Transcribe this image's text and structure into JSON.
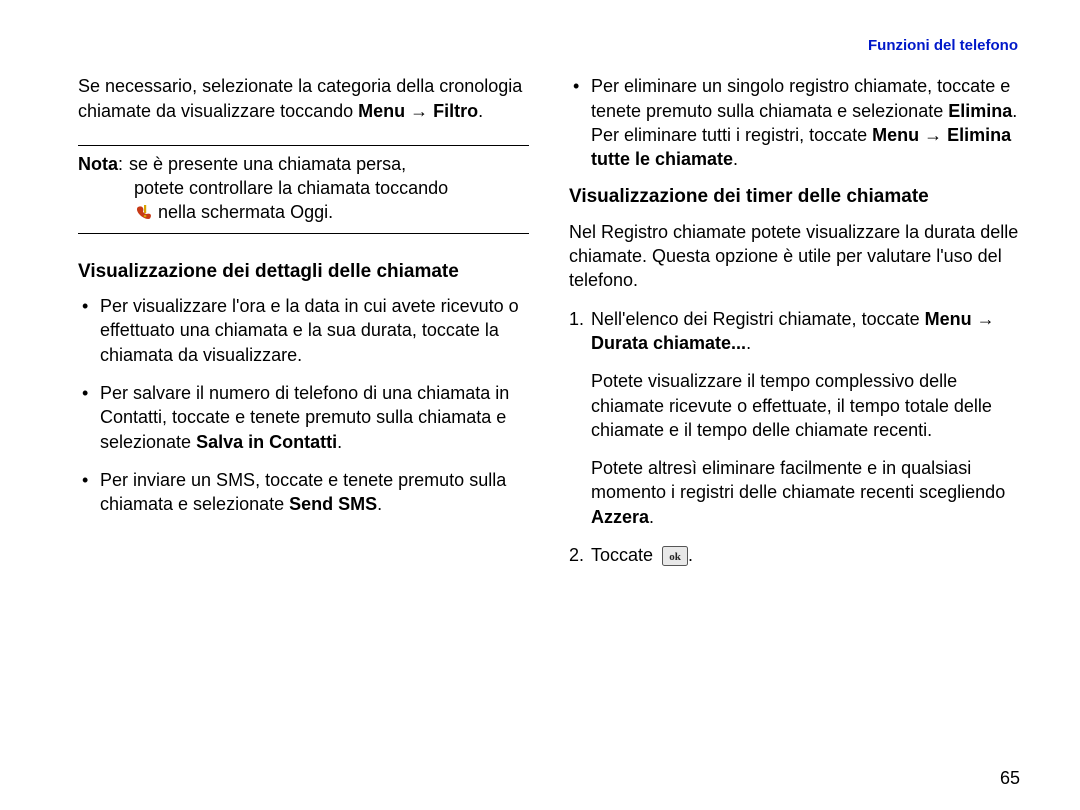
{
  "header": {
    "section_title": "Funzioni del telefono"
  },
  "left": {
    "intro_pre": "Se necessario, selezionate la categoria della cronologia chiamate da visualizzare toccando ",
    "intro_menu": "Menu",
    "intro_arrow": " → ",
    "intro_filtro": "Filtro",
    "intro_period": ".",
    "note_label": "Nota",
    "note_colon": ": ",
    "note_line1a": "se è presente una chiamata persa,",
    "note_line1b": "potete controllare la chiamata toccando",
    "note_line2": " nella schermata Oggi.",
    "subhead": "Visualizzazione dei dettagli delle chiamate",
    "bullets": [
      {
        "text": "Per visualizzare l'ora e la data in cui avete ricevuto o effettuato una chiamata e la sua durata, toccate la chiamata da visualizzare."
      },
      {
        "pre": "Per salvare il numero di telefono di una chiamata in Contatti, toccate e tenete premuto sulla chiamata e selezionate ",
        "bold": "Salva in Contatti",
        "post": "."
      },
      {
        "pre": "Per inviare un SMS, toccate e tenete premuto sulla chiamata e selezionate ",
        "bold": "Send SMS",
        "post": "."
      }
    ]
  },
  "right": {
    "bullets_top": [
      {
        "pre": "Per eliminare un singolo registro chiamate, toccate e tenete premuto sulla chiamata e selezionate ",
        "bold1": "Elimina",
        "mid": ". Per eliminare tutti i registri, toccate ",
        "bold2": "Menu",
        "arrow": " → ",
        "bold3": "Elimina tutte le chiamate",
        "post": "."
      }
    ],
    "subhead": "Visualizzazione dei timer delle chiamate",
    "intro": "Nel Registro chiamate potete visualizzare la durata delle chiamate. Questa opzione è utile per valutare l'uso del telefono.",
    "steps": {
      "one_num": "1.",
      "one_pre": "Nell'elenco dei Registri chiamate, toccate ",
      "one_bold": "Menu → Durata chiamate...",
      "one_post": ".",
      "one_sub1": "Potete visualizzare il tempo complessivo delle chiamate ricevute o effettuate, il tempo totale delle chiamate e il tempo delle chiamate recenti.",
      "one_sub2_pre": "Potete altresì eliminare facilmente e in qualsiasi momento i registri delle chiamate recenti scegliendo ",
      "one_sub2_bold": "Azzera",
      "one_sub2_post": ".",
      "two_num": "2.",
      "two_pre": "Toccate ",
      "two_post": "."
    }
  },
  "page_number": "65",
  "icons": {
    "missed_call": "missed-call-icon",
    "ok": "ok-icon"
  }
}
